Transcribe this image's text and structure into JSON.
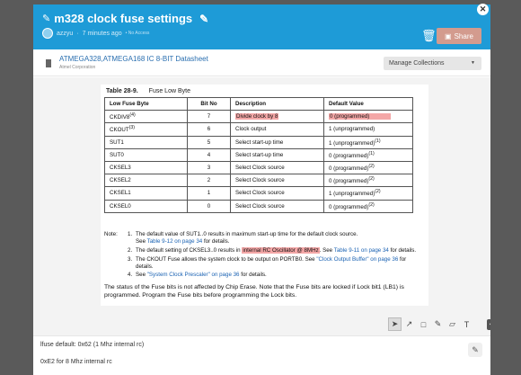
{
  "header": {
    "title": "m328 clock fuse settings",
    "author": "azzyu",
    "time_ago": "7 minutes ago",
    "time_suffix": "• No Access",
    "share_label": "Share"
  },
  "document": {
    "title": "ATMEGA328,ATMEGA168 IC 8-BIT Datasheet",
    "subtitle": "Atmel Corporation",
    "manage_label": "Manage Collections"
  },
  "datasheet": {
    "caption_num": "Table 28-9.",
    "caption_name": "Fuse Low Byte",
    "headers": [
      "Low Fuse Byte",
      "Bit No",
      "Description",
      "Default Value"
    ],
    "rows": [
      {
        "name": "CKDIV8",
        "sup": "(4)",
        "bit": "7",
        "desc": "Divide clock by 8",
        "val": "0 (programmed)",
        "vsup": ""
      },
      {
        "name": "CKOUT",
        "sup": "(3)",
        "bit": "6",
        "desc": "Clock output",
        "val": "1 (unprogrammed)",
        "vsup": ""
      },
      {
        "name": "SUT1",
        "sup": "",
        "bit": "5",
        "desc": "Select start-up time",
        "val": "1 (unprogrammed)",
        "vsup": "(1)"
      },
      {
        "name": "SUT0",
        "sup": "",
        "bit": "4",
        "desc": "Select start-up time",
        "val": "0 (programmed)",
        "vsup": "(1)"
      },
      {
        "name": "CKSEL3",
        "sup": "",
        "bit": "3",
        "desc": "Select Clock source",
        "val": "0 (programmed)",
        "vsup": "(2)"
      },
      {
        "name": "CKSEL2",
        "sup": "",
        "bit": "2",
        "desc": "Select Clock source",
        "val": "0 (programmed)",
        "vsup": "(2)"
      },
      {
        "name": "CKSEL1",
        "sup": "",
        "bit": "1",
        "desc": "Select Clock source",
        "val": "1 (unprogrammed)",
        "vsup": "(2)"
      },
      {
        "name": "CKSEL0",
        "sup": "",
        "bit": "0",
        "desc": "Select Clock source",
        "val": "0 (programmed)",
        "vsup": "(2)"
      }
    ],
    "notes_label": "Note:",
    "note1_a": "The default value of SUT1..0 results in maximum start-up time for the default clock source.",
    "note1_b": "See ",
    "note1_link": "Table 9-12 on page 34",
    "note1_c": " for details.",
    "note2_a": "The default setting of CKSEL3..0 results in ",
    "note2_hl": "internal RC Oscillator @ 8MHz",
    "note2_b": ". See ",
    "note2_link": "Table 9-11 on page 34",
    "note2_c": " for details.",
    "note3_a": "The CKOUT Fuse allows the system clock to be output on PORTB0. See ",
    "note3_link": "\"Clock Output Buffer\" on page 36",
    "note3_b": " for details.",
    "note4_a": "See ",
    "note4_link": "\"System Clock Prescaler\" on page 36",
    "note4_b": " for details.",
    "status_text": "The status of the Fuse bits is not affected by Chip Erase. Note that the Fuse bits are locked if Lock bit1 (LB1) is programmed. Program the Fuse bits before programming the Lock bits."
  },
  "annotations": {
    "note1": "lfuse default: 0x62 (1 Mhz internal rc)",
    "note2": "0xE2 for 8 Mhz internal rc"
  },
  "colors": {
    "header_bg": "#1e9bd7",
    "highlight": "#f4a7a7",
    "share_bg": "#d39b8e",
    "link": "#1a62b3"
  }
}
